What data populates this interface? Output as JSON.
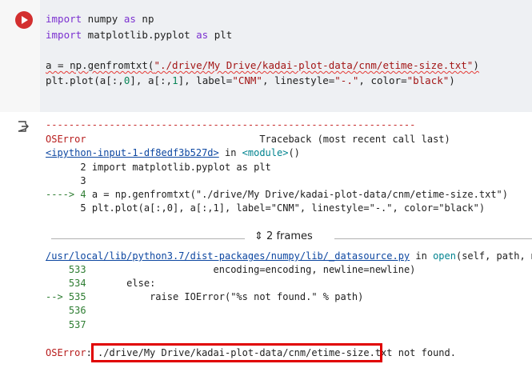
{
  "code_cell": {
    "line1": {
      "kw1": "import",
      "mod": " numpy ",
      "kw2": "as",
      "rest": " np"
    },
    "line2": {
      "kw1": "import",
      "mod": " matplotlib.pyplot ",
      "kw2": "as",
      "rest": " plt"
    },
    "line4": {
      "pre": "a = np.genfromtxt(",
      "str": "\"./drive/My Drive/kadai-plot-data/cnm/etime-size.txt\"",
      "post": ")"
    },
    "line5": {
      "a": "plt.plot(a[:,",
      "n0": "0",
      "b": "], a[:,",
      "n1": "1",
      "c": "], label=",
      "s1": "\"CNM\"",
      "d": ", linestyle=",
      "s2": "\"-.\"",
      "e": ", color=",
      "s3": "\"black\"",
      "f": ")"
    }
  },
  "output": {
    "dash_line": "----------------------------------------------------------------",
    "error_name": "OSError",
    "traceback_label": "Traceback (most recent call last)",
    "input_link": "<ipython-input-1-df8edf3b527d>",
    "in_word": " in ",
    "module": "<module>",
    "module_tail": "()",
    "tb": [
      {
        "prefix": "      ",
        "num": "2",
        "text": " import matplotlib.pyplot as plt"
      },
      {
        "prefix": "      ",
        "num": "3",
        "text": ""
      },
      {
        "prefix": "----> ",
        "num": "4",
        "text": " a = np.genfromtxt(\"./drive/My Drive/kadai-plot-data/cnm/etime-size.txt\")"
      },
      {
        "prefix": "      ",
        "num": "5",
        "text": " plt.plot(a[:,0], a[:,1], label=\"CNM\", linestyle=\"-.\", color=\"black\")"
      }
    ],
    "frames_label": "2 frames",
    "frames_icon": "unfold-icon",
    "lib_path": "/usr/local/lib/python3.7/dist-packages/numpy/lib/_datasource.py",
    "lib_in": " in ",
    "lib_func": "open",
    "lib_tail": "(self, path, mode",
    "lib_lines": [
      {
        "prefix": "    ",
        "num": "533",
        "text": "                      encoding=encoding, newline=newline)"
      },
      {
        "prefix": "    ",
        "num": "534",
        "text": "       else:"
      },
      {
        "prefix": "--> ",
        "num": "535",
        "text": "           raise IOError(\"%s not found.\" % path)"
      },
      {
        "prefix": "    ",
        "num": "536",
        "text": ""
      },
      {
        "prefix": "    ",
        "num": "537",
        "text": ""
      }
    ],
    "final_error": "OSError",
    "final_colon": ": ",
    "final_path": "./drive/My Drive/kadai-plot-data/cnm/etime-size.txt",
    "final_tail": " not found."
  },
  "icons": {
    "run": "run-cell-icon",
    "output": "output-arrow-icon"
  }
}
